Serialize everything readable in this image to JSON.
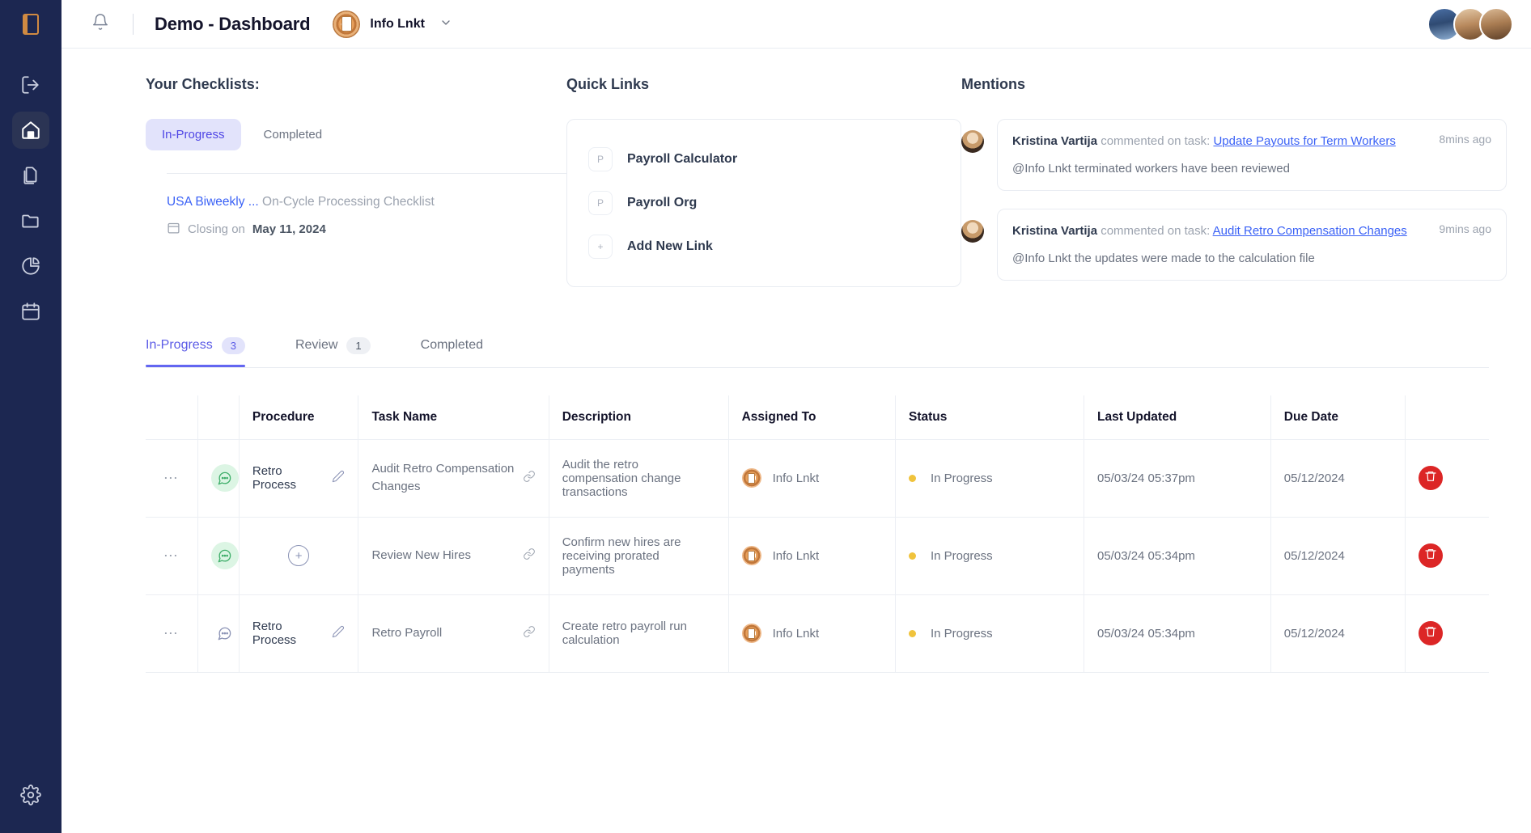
{
  "sidebar": {
    "logo_icon": "book-logo-icon",
    "items": [
      {
        "icon": "logout-icon",
        "name": "sidebar-item-logout",
        "active": false
      },
      {
        "icon": "home-icon",
        "name": "sidebar-item-home",
        "active": true
      },
      {
        "icon": "documents-icon",
        "name": "sidebar-item-documents",
        "active": false
      },
      {
        "icon": "folder-icon",
        "name": "sidebar-item-folder",
        "active": false
      },
      {
        "icon": "pie-chart-icon",
        "name": "sidebar-item-reports",
        "active": false
      },
      {
        "icon": "calendar-icon",
        "name": "sidebar-item-calendar",
        "active": false
      }
    ],
    "settings": {
      "icon": "gear-icon",
      "name": "sidebar-item-settings"
    }
  },
  "header": {
    "bell_icon": "bell-icon",
    "title": "Demo - Dashboard",
    "org_name": "Info Lnkt",
    "org_icon": "org-avatar-icon",
    "chevron": "⌄"
  },
  "checklists": {
    "title": "Your Checklists:",
    "tabs": [
      {
        "label": "In-Progress",
        "active": true
      },
      {
        "label": "Completed",
        "active": false
      }
    ],
    "item": {
      "link_text": "USA Biweekly ...",
      "rest_text": "On-Cycle Processing Checklist",
      "closing_prefix": "Closing on",
      "closing_date": "May 11, 2024",
      "calendar_icon": "calendar-icon"
    }
  },
  "quick_links": {
    "title": "Quick Links",
    "items": [
      {
        "badge": "P",
        "label": "Payroll Calculator",
        "name": "quick-link-payroll-calculator"
      },
      {
        "badge": "P",
        "label": "Payroll Org",
        "name": "quick-link-payroll-org"
      },
      {
        "badge": "+",
        "label": "Add New Link",
        "name": "add-new-link-button"
      }
    ]
  },
  "mentions": {
    "title": "Mentions",
    "items": [
      {
        "author": "Kristina Vartija",
        "action": " commented on task: ",
        "task_link": "Update Payouts for Term Workers",
        "time": "8mins ago",
        "body": "@Info Lnkt terminated workers have been reviewed"
      },
      {
        "author": "Kristina Vartija",
        "action": " commented on task: ",
        "task_link": "Audit Retro Compensation Changes",
        "time": "9mins ago",
        "body": "@Info Lnkt the updates were made to the calculation file"
      }
    ]
  },
  "task_tabs": [
    {
      "label": "In-Progress",
      "count": "3",
      "active": true
    },
    {
      "label": "Review",
      "count": "1",
      "active": false
    },
    {
      "label": "Completed",
      "count": "",
      "active": false
    }
  ],
  "table": {
    "columns": [
      "",
      "",
      "Procedure",
      "Task Name",
      "Description",
      "Assigned To",
      "Status",
      "Last Updated",
      "Due Date",
      ""
    ],
    "rows": [
      {
        "menu_icon": "more-options-icon",
        "chat_icon": "comment-icon",
        "chat_highlight": true,
        "procedure": "Retro Process",
        "procedure_edit": true,
        "procedure_add": false,
        "task_name": "Audit Retro Compensation Changes",
        "link_icon": "link-icon",
        "description": "Audit the retro compensation change transactions",
        "assigned_to": "Info Lnkt",
        "status": "In Progress",
        "status_color": "#f0c33c",
        "last_updated": "05/03/24 05:37pm",
        "due_date": "05/12/2024",
        "delete_icon": "trash-icon"
      },
      {
        "menu_icon": "more-options-icon",
        "chat_icon": "comment-icon",
        "chat_highlight": true,
        "procedure": "",
        "procedure_edit": false,
        "procedure_add": true,
        "task_name": "Review New Hires",
        "link_icon": "link-icon",
        "description": "Confirm new hires are receiving prorated payments",
        "assigned_to": "Info Lnkt",
        "status": "In Progress",
        "status_color": "#f0c33c",
        "last_updated": "05/03/24 05:34pm",
        "due_date": "05/12/2024",
        "delete_icon": "trash-icon"
      },
      {
        "menu_icon": "more-options-icon",
        "chat_icon": "comment-icon",
        "chat_highlight": false,
        "procedure": "Retro Process",
        "procedure_edit": true,
        "procedure_add": false,
        "task_name": "Retro Payroll",
        "link_icon": "link-icon",
        "description": "Create retro payroll run calculation",
        "assigned_to": "Info Lnkt",
        "status": "In Progress",
        "status_color": "#f0c33c",
        "last_updated": "05/03/24 05:34pm",
        "due_date": "05/12/2024",
        "delete_icon": "trash-icon"
      }
    ]
  },
  "colors": {
    "sidebar_bg": "#1c2751",
    "accent": "#5b5be6",
    "link": "#3b62f6",
    "status_yellow": "#f0c33c",
    "delete_red": "#dc2626",
    "chat_green_bg": "#dcf5e4"
  }
}
